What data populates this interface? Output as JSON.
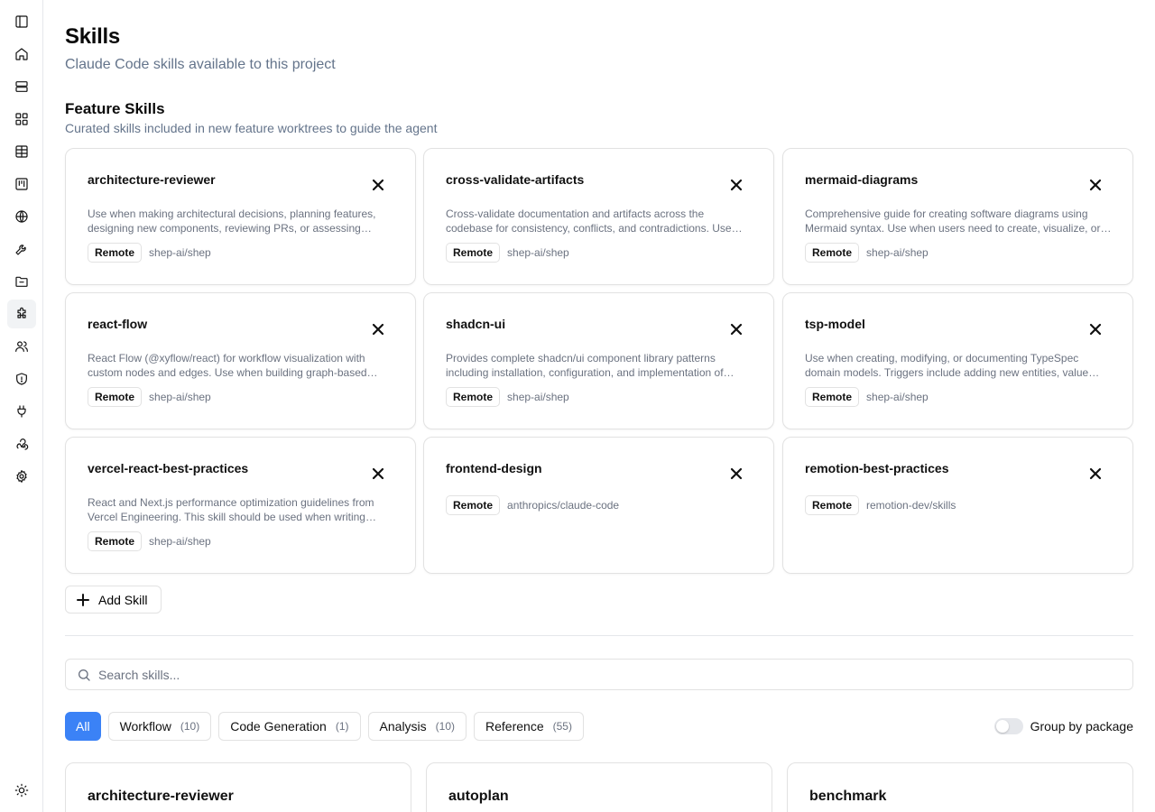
{
  "sidebar": {
    "icons": [
      "sidebar-toggle-icon",
      "home-icon",
      "server-icon",
      "grid-icon",
      "table-icon",
      "board-icon",
      "globe-icon",
      "wrench-icon",
      "folder-icon",
      "puzzle-icon",
      "users-icon",
      "shield-icon",
      "plug-icon",
      "webhook-icon",
      "gear-icon"
    ],
    "active": "puzzle-icon",
    "bottom_icon": "sun-icon"
  },
  "page": {
    "title": "Skills",
    "subtitle": "Claude Code skills available to this project"
  },
  "feature": {
    "title": "Feature Skills",
    "subtitle": "Curated skills included in new feature worktrees to guide the agent",
    "cards": [
      {
        "name": "architecture-reviewer",
        "desc": "Use when making architectural decisions, planning features, designing new components, reviewing PRs, or assessing technical debt.",
        "badge": "Remote",
        "source": "shep-ai/shep"
      },
      {
        "name": "cross-validate-artifacts",
        "desc": "Cross-validate documentation and artifacts across the codebase for consistency, conflicts, and contradictions. Use before releases.",
        "badge": "Remote",
        "source": "shep-ai/shep"
      },
      {
        "name": "mermaid-diagrams",
        "desc": "Comprehensive guide for creating software diagrams using Mermaid syntax. Use when users need to create, visualize, or document systems.",
        "badge": "Remote",
        "source": "shep-ai/shep"
      },
      {
        "name": "react-flow",
        "desc": "React Flow (@xyflow/react) for workflow visualization with custom nodes and edges. Use when building graph-based editors.",
        "badge": "Remote",
        "source": "shep-ai/shep"
      },
      {
        "name": "shadcn-ui",
        "desc": "Provides complete shadcn/ui component library patterns including installation, configuration, and implementation of components.",
        "badge": "Remote",
        "source": "shep-ai/shep"
      },
      {
        "name": "tsp-model",
        "desc": "Use when creating, modifying, or documenting TypeSpec domain models. Triggers include adding new entities, value objects, and enums.",
        "badge": "Remote",
        "source": "shep-ai/shep"
      },
      {
        "name": "vercel-react-best-practices",
        "desc": "React and Next.js performance optimization guidelines from Vercel Engineering. This skill should be used when writing React code.",
        "badge": "Remote",
        "source": "shep-ai/shep"
      },
      {
        "name": "frontend-design",
        "desc": "",
        "badge": "Remote",
        "source": "anthropics/claude-code"
      },
      {
        "name": "remotion-best-practices",
        "desc": "",
        "badge": "Remote",
        "source": "remotion-dev/skills"
      }
    ],
    "add_label": "Add Skill"
  },
  "search": {
    "placeholder": "Search skills..."
  },
  "filters": [
    {
      "label": "All",
      "count": ""
    },
    {
      "label": "Workflow",
      "count": "(10)"
    },
    {
      "label": "Code Generation",
      "count": "(1)"
    },
    {
      "label": "Analysis",
      "count": "(10)"
    },
    {
      "label": "Reference",
      "count": "(55)"
    }
  ],
  "group_by_label": "Group by package",
  "skills_list": [
    {
      "name": "architecture-reviewer"
    },
    {
      "name": "autoplan"
    },
    {
      "name": "benchmark"
    }
  ],
  "colors": {
    "accent": "#3b82f6",
    "muted": "#64748b",
    "border": "#e2e2e2"
  }
}
